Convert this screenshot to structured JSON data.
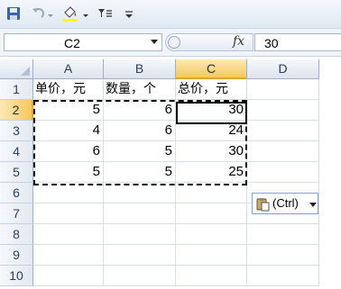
{
  "name_box": {
    "value": "C2"
  },
  "formula_bar": {
    "fx_label": "fx",
    "value": "30"
  },
  "columns": [
    "A",
    "B",
    "C",
    "D"
  ],
  "rows": [
    "1",
    "2",
    "3",
    "4",
    "5",
    "6",
    "7",
    "8",
    "9",
    "10"
  ],
  "sheet": {
    "header_row": [
      "单价，元",
      "数量，个",
      "总价，元"
    ],
    "data_rows": [
      [
        "5",
        "6",
        "30"
      ],
      [
        "4",
        "6",
        "24"
      ],
      [
        "6",
        "5",
        "30"
      ],
      [
        "5",
        "5",
        "25"
      ]
    ]
  },
  "selection": {
    "active_cell": "C2",
    "copied_range": "A1:C5"
  },
  "paste_options": {
    "label": "(Ctrl)"
  },
  "colors": {
    "selected_header": "#f7c95c",
    "ribbon": "#dfe8f4"
  }
}
